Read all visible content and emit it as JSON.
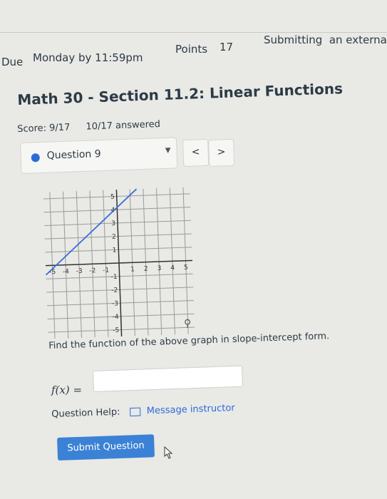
{
  "header": {
    "due_label": "Due",
    "due_value": "Monday by 11:59pm",
    "points_label": "Points",
    "points_value": "17",
    "submitting_label": "Submitting",
    "submitting_value": "an externa"
  },
  "assignment": {
    "title": "Math 30 - Section 11.2: Linear Functions",
    "score": "Score: 9/17",
    "answered": "10/17 answered"
  },
  "question_nav": {
    "current": "Question 9",
    "prev": "<",
    "next": ">"
  },
  "graph": {
    "x_ticks": [
      "-5",
      "-4",
      "-3",
      "-2",
      "-1",
      "1",
      "2",
      "3",
      "4",
      "5"
    ],
    "y_ticks": [
      "5",
      "4",
      "3",
      "2",
      "1",
      "-1",
      "-2",
      "-3",
      "-4",
      "-5"
    ],
    "line_color": "#3a6fd6"
  },
  "chart_data": {
    "type": "line",
    "series": [
      {
        "x": [
          -5.5,
          1.5
        ],
        "y": [
          -0.7,
          5.5
        ]
      }
    ],
    "xlim": [
      -5.5,
      5.5
    ],
    "ylim": [
      -5.5,
      5.5
    ],
    "grid": true
  },
  "question": {
    "instruction": "Find the function of the above graph in slope-intercept form.",
    "fx_label": "f(x) =",
    "answer_value": ""
  },
  "help": {
    "label": "Question Help:",
    "message_link": "Message instructor"
  },
  "submit": {
    "label": "Submit Question"
  },
  "colors": {
    "accent": "#3b82d6",
    "page_bg": "#e9e9e6",
    "dot": "#2b6bd8"
  },
  "icons": {
    "magnify": "magnify-icon",
    "mail": "mail-icon",
    "cursor": "cursor-icon",
    "caret": "caret-down-icon"
  }
}
